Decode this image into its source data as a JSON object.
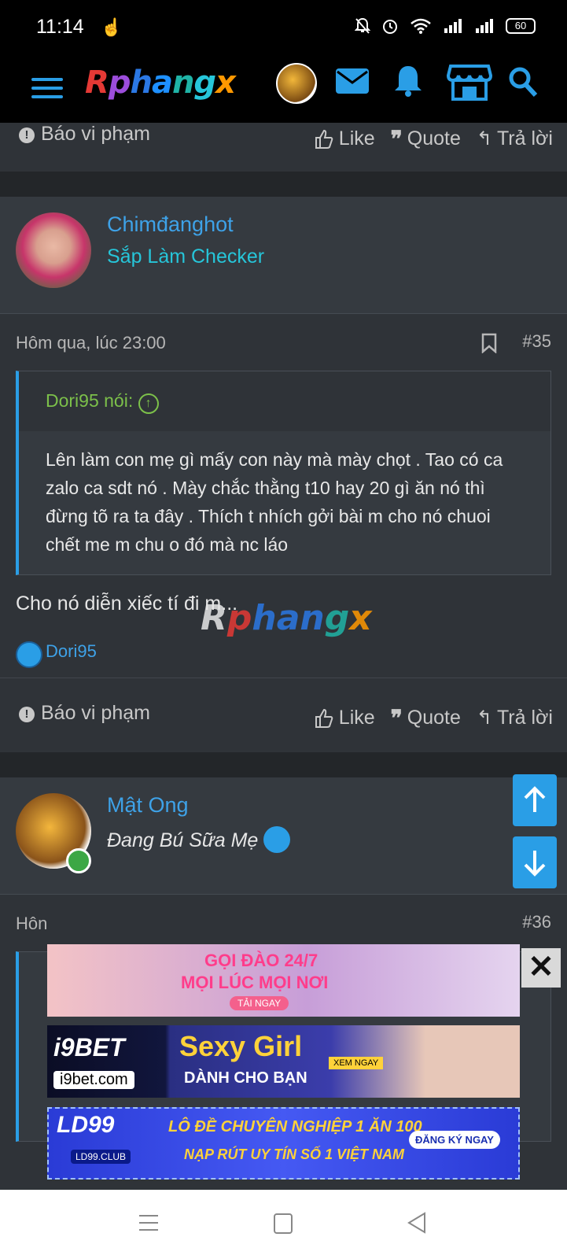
{
  "status_bar": {
    "time": "11:14",
    "battery": "60"
  },
  "header": {
    "logo": "Rphangx"
  },
  "posts": [
    {
      "actions": {
        "report": "Báo vi phạm",
        "like": "Like",
        "quote": "Quote",
        "reply": "Trả lời"
      }
    },
    {
      "username": "Chimđanghot",
      "user_title": "Sắp Làm Checker",
      "date": "Hôm qua, lúc 23:00",
      "post_number": "#35",
      "quote_author": "Dori95 nói:",
      "quote_text": "Lên làm con mẹ gì mấy con này mà mày chọt . Tao có ca zalo ca sdt nó . Mày chắc thằng t10 hay 20 gì ăn nó thì đừng tõ ra ta đây . Thích t nhích gởi bài m cho nó chuoi chết me m chu o đó mà nc láo",
      "text": "Cho nó diễn xiếc tí đi m...",
      "reaction_user": "Dori95",
      "actions": {
        "report": "Báo vi phạm",
        "like": "Like",
        "quote": "Quote",
        "reply": "Trả lời"
      }
    },
    {
      "username": "Mật Ong",
      "user_title": "Đang Bú Sữa Mẹ",
      "date_partial": "Hôn",
      "post_number_partial": "#36"
    }
  ],
  "ads": [
    {
      "line1": "GỌI ĐÀO 24/7",
      "line2": "MỌI LÚC MỌI NƠI",
      "cta": "TẢI NGAY"
    },
    {
      "brand": "i9BET",
      "site": "i9bet.com",
      "headline": "Sexy Girl",
      "sub": "DÀNH CHO BẠN",
      "cta": "XEM NGAY"
    },
    {
      "brand": "LD99",
      "site": "LD99.CLUB",
      "line1": "LÔ ĐỀ CHUYÊN NGHIỆP 1 ĂN 100",
      "line2": "NẠP RÚT UY TÍN SỐ 1 VIỆT NAM",
      "cta": "ĐĂNG KÝ NGAY"
    }
  ],
  "colors": {
    "accent": "#2a9ee6",
    "background": "#2f3338",
    "quote_author": "#7cc04a"
  }
}
